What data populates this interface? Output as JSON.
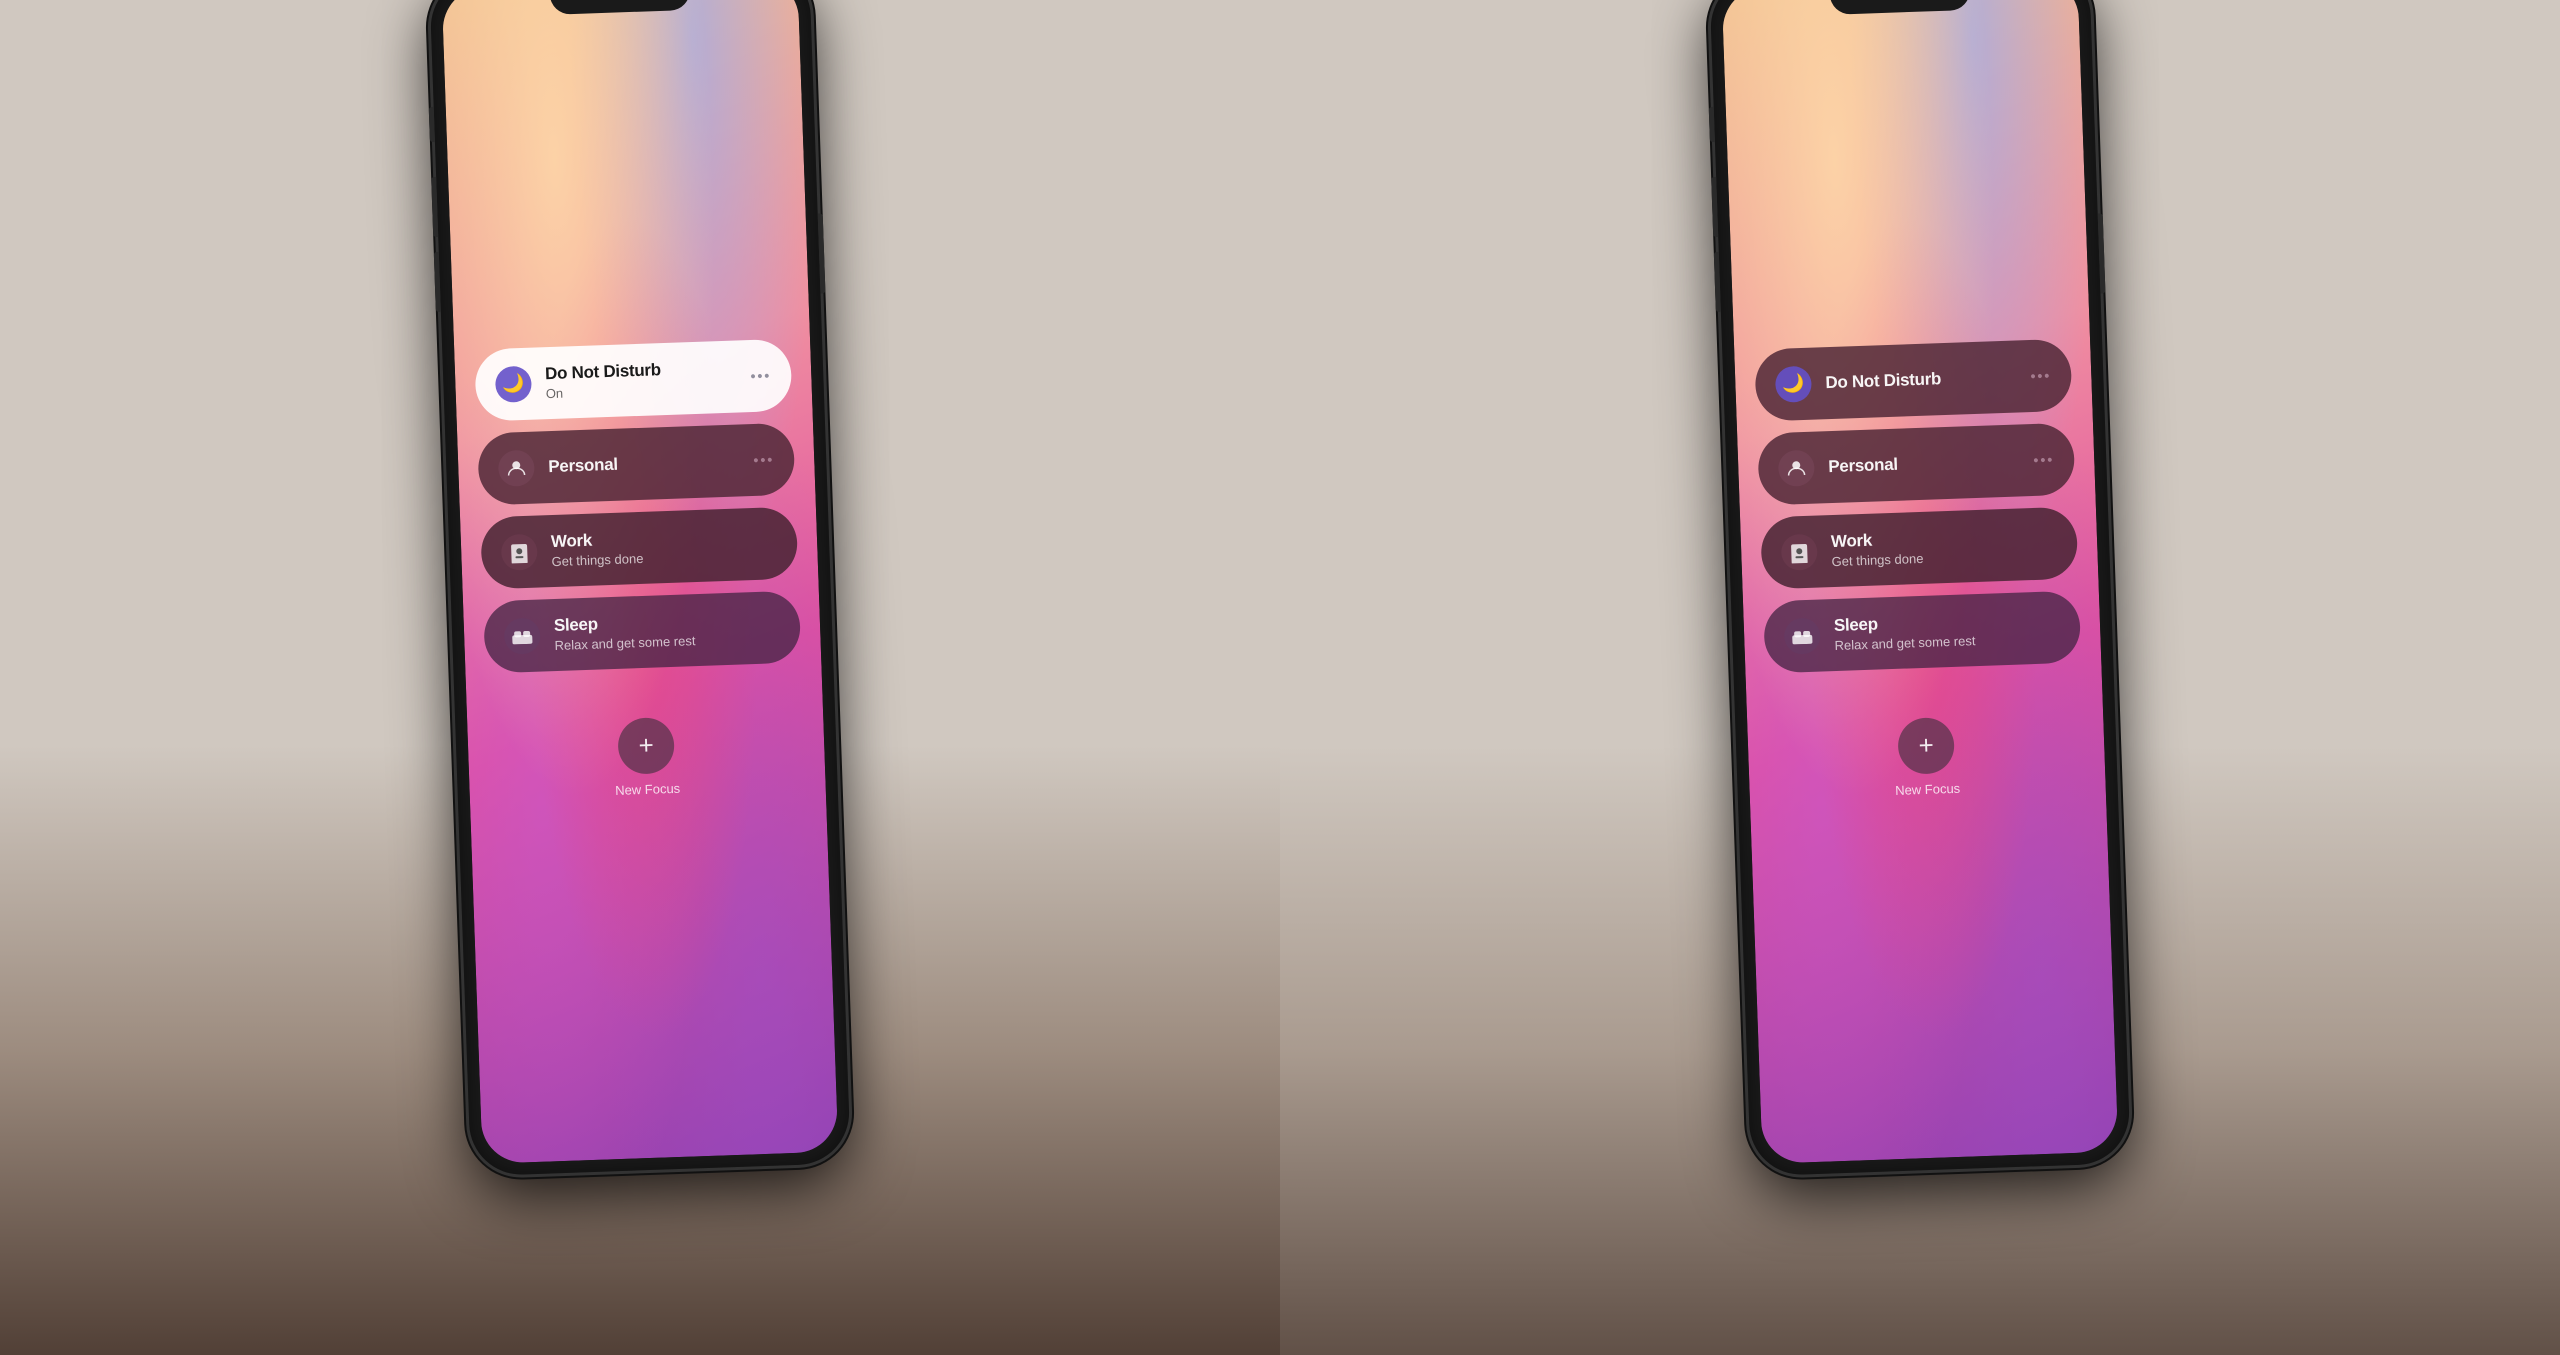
{
  "left_phone": {
    "focus_items": [
      {
        "id": "dnd",
        "icon": "🌙",
        "title": "Do Not Disturb",
        "subtitle": "On",
        "has_more": true,
        "active": true
      },
      {
        "id": "personal",
        "icon": "👤",
        "title": "Personal",
        "subtitle": "",
        "has_more": true,
        "active": false
      },
      {
        "id": "work",
        "icon": "🪪",
        "title": "Work",
        "subtitle": "Get things done",
        "has_more": false,
        "active": false
      },
      {
        "id": "sleep",
        "icon": "🛏",
        "title": "Sleep",
        "subtitle": "Relax and get some rest",
        "has_more": false,
        "active": false
      }
    ],
    "new_focus": {
      "label": "New Focus",
      "icon": "+"
    }
  },
  "right_phone": {
    "focus_items": [
      {
        "id": "dnd",
        "icon": "🌙",
        "title": "Do Not Disturb",
        "subtitle": "",
        "has_more": true,
        "active": false
      },
      {
        "id": "personal",
        "icon": "👤",
        "title": "Personal",
        "subtitle": "",
        "has_more": true,
        "active": false
      },
      {
        "id": "work",
        "icon": "🪪",
        "title": "Work",
        "subtitle": "Get things done",
        "has_more": false,
        "active": false
      },
      {
        "id": "sleep",
        "icon": "🛏",
        "title": "Sleep",
        "subtitle": "Relax and get some rest",
        "has_more": false,
        "active": false
      }
    ],
    "new_focus": {
      "label": "New Focus",
      "icon": "+"
    }
  }
}
